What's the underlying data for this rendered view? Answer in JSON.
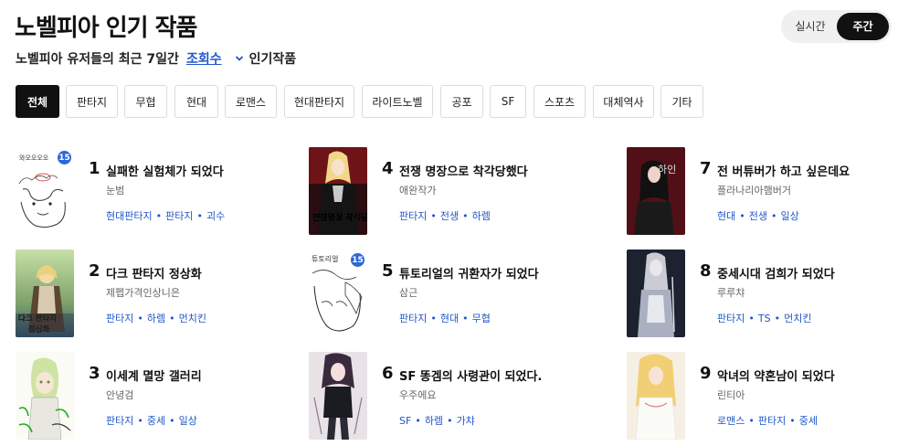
{
  "header": {
    "title": "노벨피아 인기 작품",
    "toggle": {
      "realtime": "실시간",
      "weekly": "주간"
    }
  },
  "subtitle": {
    "prefix": "노벨피아 유저들의 최근 7일간",
    "sort": "조회수",
    "suffix": "인기작품"
  },
  "categories": [
    "전체",
    "판타지",
    "무협",
    "현대",
    "로맨스",
    "현대판타지",
    "라이트노벨",
    "공포",
    "SF",
    "스포츠",
    "대체역사",
    "기타"
  ],
  "items": [
    {
      "rank": "1",
      "title": "실패한 실험체가 되었다",
      "author": "눈범",
      "tags": [
        "현대판타지",
        "판타지",
        "괴수"
      ],
      "badge": "15",
      "cover_text": "와오오오오"
    },
    {
      "rank": "2",
      "title": "다크 판타지 정상화",
      "author": "제펩가격인상니은",
      "tags": [
        "판타지",
        "하렘",
        "먼치킨"
      ],
      "badge": "",
      "cover_text": "다크 판타지 정상화"
    },
    {
      "rank": "3",
      "title": "이세계 멸망 갤러리",
      "author": "안녕검",
      "tags": [
        "판타지",
        "중세",
        "일상"
      ],
      "badge": "",
      "cover_text": ""
    },
    {
      "rank": "4",
      "title": "전쟁 명장으로 착각당했다",
      "author": "애완작가",
      "tags": [
        "판타지",
        "전생",
        "하렘"
      ],
      "badge": "",
      "cover_text": "전쟁명장 착각당했다"
    },
    {
      "rank": "5",
      "title": "튜토리얼의 귀환자가 되었다",
      "author": "삼근",
      "tags": [
        "판타지",
        "현대",
        "무협"
      ],
      "badge": "15",
      "cover_text": "튜토리얼"
    },
    {
      "rank": "6",
      "title": "SF 똥겜의 사령관이 되었다.",
      "author": "우주에요",
      "tags": [
        "SF",
        "하렘",
        "가챠"
      ],
      "badge": "",
      "cover_text": ""
    },
    {
      "rank": "7",
      "title": "전 버튜버가 하고 싶은데요",
      "author": "플라나리아햄버거",
      "tags": [
        "현대",
        "전생",
        "일상"
      ],
      "badge": "",
      "cover_text": "하인"
    },
    {
      "rank": "8",
      "title": "중세시대 검희가 되었다",
      "author": "루루챠",
      "tags": [
        "판타지",
        "TS",
        "먼치킨"
      ],
      "badge": "",
      "cover_text": ""
    },
    {
      "rank": "9",
      "title": "악녀의 약혼남이 되었다",
      "author": "린티아",
      "tags": [
        "로맨스",
        "판타지",
        "중세"
      ],
      "badge": "",
      "cover_text": ""
    }
  ],
  "colors": {
    "accent": "#1f56c9",
    "badge": "#2f66d8",
    "active_chip": "#111111"
  }
}
